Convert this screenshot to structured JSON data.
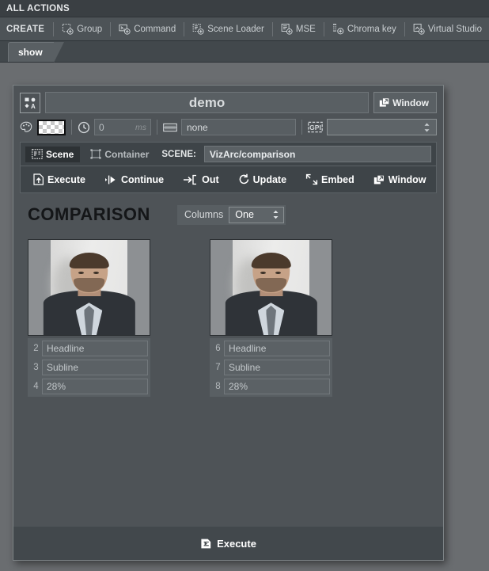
{
  "header": {
    "title": "ALL ACTIONS"
  },
  "create_toolbar": {
    "label": "CREATE",
    "items": [
      {
        "label": "Group",
        "icon": "group-add-icon"
      },
      {
        "label": "Command",
        "icon": "command-add-icon"
      },
      {
        "label": "Scene Loader",
        "icon": "scene-loader-add-icon"
      },
      {
        "label": "MSE",
        "icon": "mse-add-icon"
      },
      {
        "label": "Chroma key",
        "icon": "chroma-key-add-icon"
      },
      {
        "label": "Virtual Studio",
        "icon": "virtual-studio-add-icon"
      }
    ]
  },
  "tabs": [
    {
      "label": "show",
      "active": true
    }
  ],
  "panel": {
    "title_icon": "shapes-text-icon",
    "name": "demo",
    "window_button": {
      "label": "Window",
      "icon": "window-icon"
    },
    "props": {
      "palette_icon": "palette-icon",
      "swatch": "transparent-checker",
      "clock_icon": "clock-icon",
      "delay_value": "0",
      "delay_unit": "ms",
      "keyboard_icon": "keyboard-icon",
      "shortcut_value": "none",
      "gpi_icon": "gpi-icon",
      "gpi_value": ""
    },
    "target": {
      "scene_tab": "Scene",
      "scene_icon": "scene-icon",
      "container_tab": "Container",
      "container_icon": "container-icon",
      "scene_label": "SCENE:",
      "scene_value": "VizArc/comparison"
    },
    "commands": [
      {
        "label": "Execute",
        "icon": "execute-icon"
      },
      {
        "label": "Continue",
        "icon": "continue-icon"
      },
      {
        "label": "Out",
        "icon": "out-icon"
      },
      {
        "label": "Update",
        "icon": "update-icon"
      },
      {
        "label": "Embed",
        "icon": "embed-icon"
      },
      {
        "label": "Window",
        "icon": "window-icon"
      }
    ],
    "form": {
      "title": "COMPARISON",
      "columns_label": "Columns",
      "columns_value": "One",
      "cards": [
        {
          "image_alt": "portrait-photo",
          "fields": [
            {
              "num": "2",
              "value": "Headline"
            },
            {
              "num": "3",
              "value": "Subline"
            },
            {
              "num": "4",
              "value": "28%"
            }
          ]
        },
        {
          "image_alt": "portrait-photo",
          "fields": [
            {
              "num": "6",
              "value": "Headline"
            },
            {
              "num": "7",
              "value": "Subline"
            },
            {
              "num": "8",
              "value": "28%"
            }
          ]
        }
      ]
    },
    "footer": {
      "execute_label": "Execute",
      "execute_icon": "execute-icon"
    }
  },
  "colors": {
    "outer_bg": "#6a6d70",
    "panel_bg": "#4e5357",
    "header_bg": "#3a3f43",
    "toolbar_bg": "#4d5357",
    "dark_bar": "#3e4448",
    "field_bg": "#5b6165",
    "text": "#d7dadc"
  }
}
